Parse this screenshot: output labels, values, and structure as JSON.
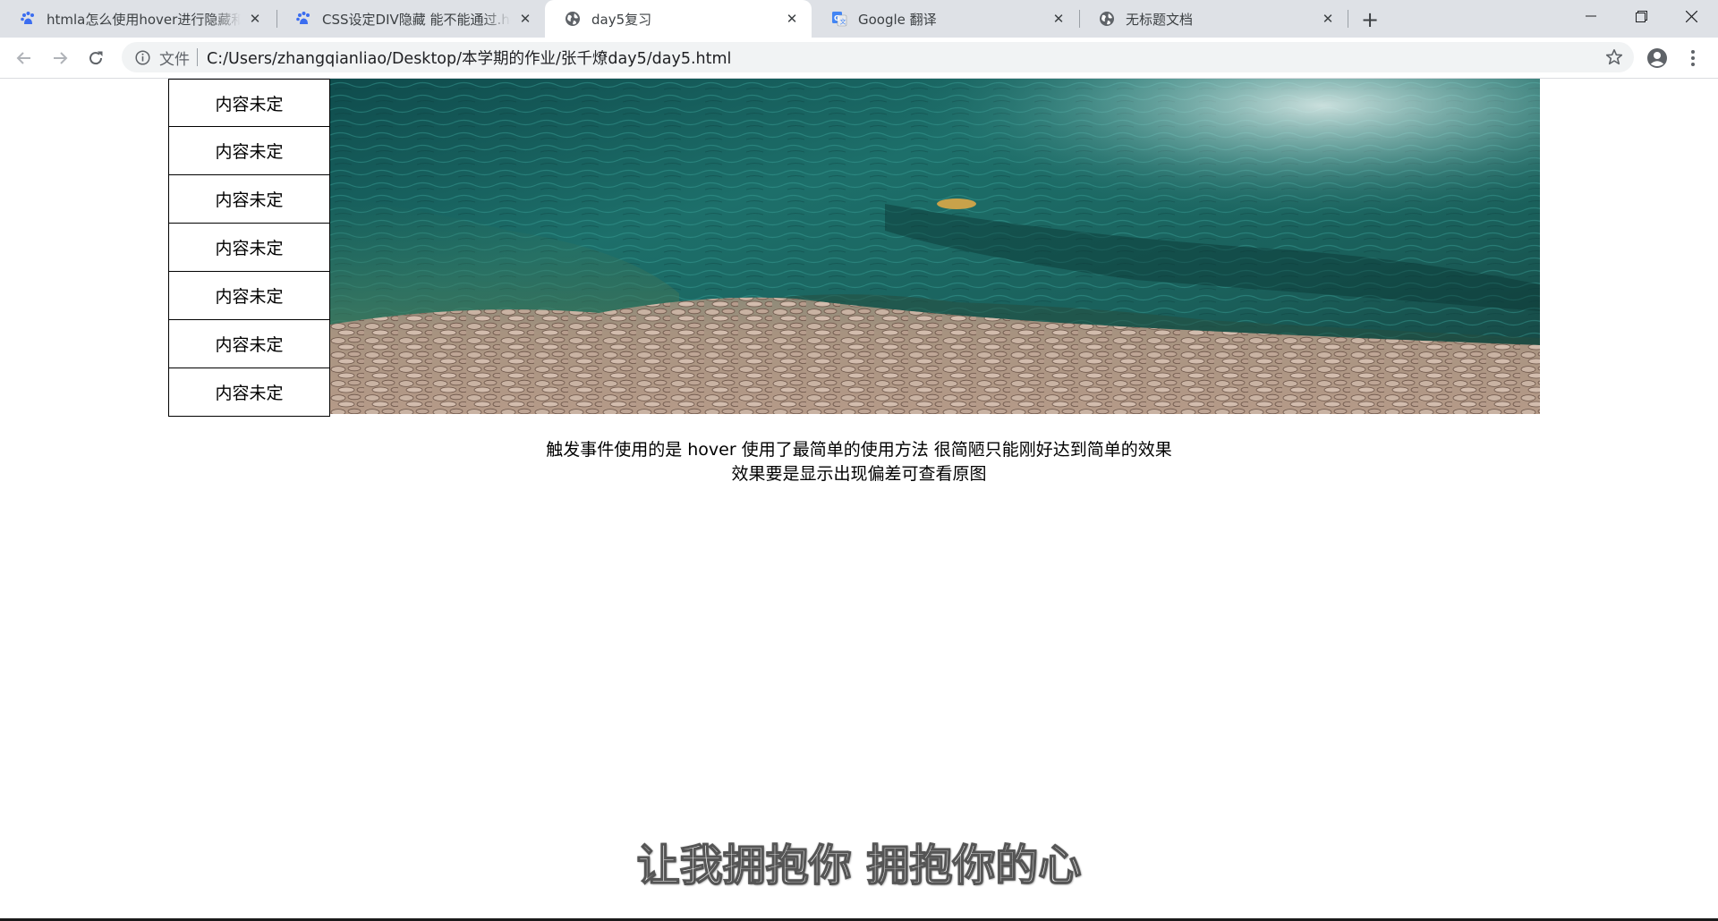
{
  "browser": {
    "tabs": [
      {
        "title": "htmla怎么使用hover进行隐藏和显示",
        "icon": "baidu-paw-icon",
        "active": false
      },
      {
        "title": "CSS设定DIV隐藏 能不能通过.hover",
        "icon": "baidu-paw-icon",
        "active": false
      },
      {
        "title": "day5复习",
        "icon": "globe-icon",
        "active": true
      },
      {
        "title": "Google 翻译",
        "icon": "google-translate-icon",
        "active": false
      },
      {
        "title": "无标题文档",
        "icon": "globe-icon",
        "active": false
      }
    ],
    "close_glyph": "✕",
    "new_tab_glyph": "+",
    "address": {
      "chip": "文件",
      "url": "C:/Users/zhangqianliao/Desktop/本学期的作业/张千燎day5/day5.html"
    }
  },
  "page": {
    "menu_items": [
      "内容未定",
      "内容未定",
      "内容未定",
      "内容未定",
      "内容未定",
      "内容未定",
      "内容未定"
    ],
    "caption_line1": "触发事件使用的是 hover 使用了最简单的使用方法 很简陋只能刚好达到简单的效果",
    "caption_line2": "效果要是显示出现偏差可查看原图"
  },
  "video_subtitle": "让我拥抱你 拥抱你的心",
  "colors": {
    "tabstrip": "#dee1e6",
    "omnibox": "#f1f3f4",
    "water": "#1d6f6a",
    "pebbles": "#b59a88"
  }
}
